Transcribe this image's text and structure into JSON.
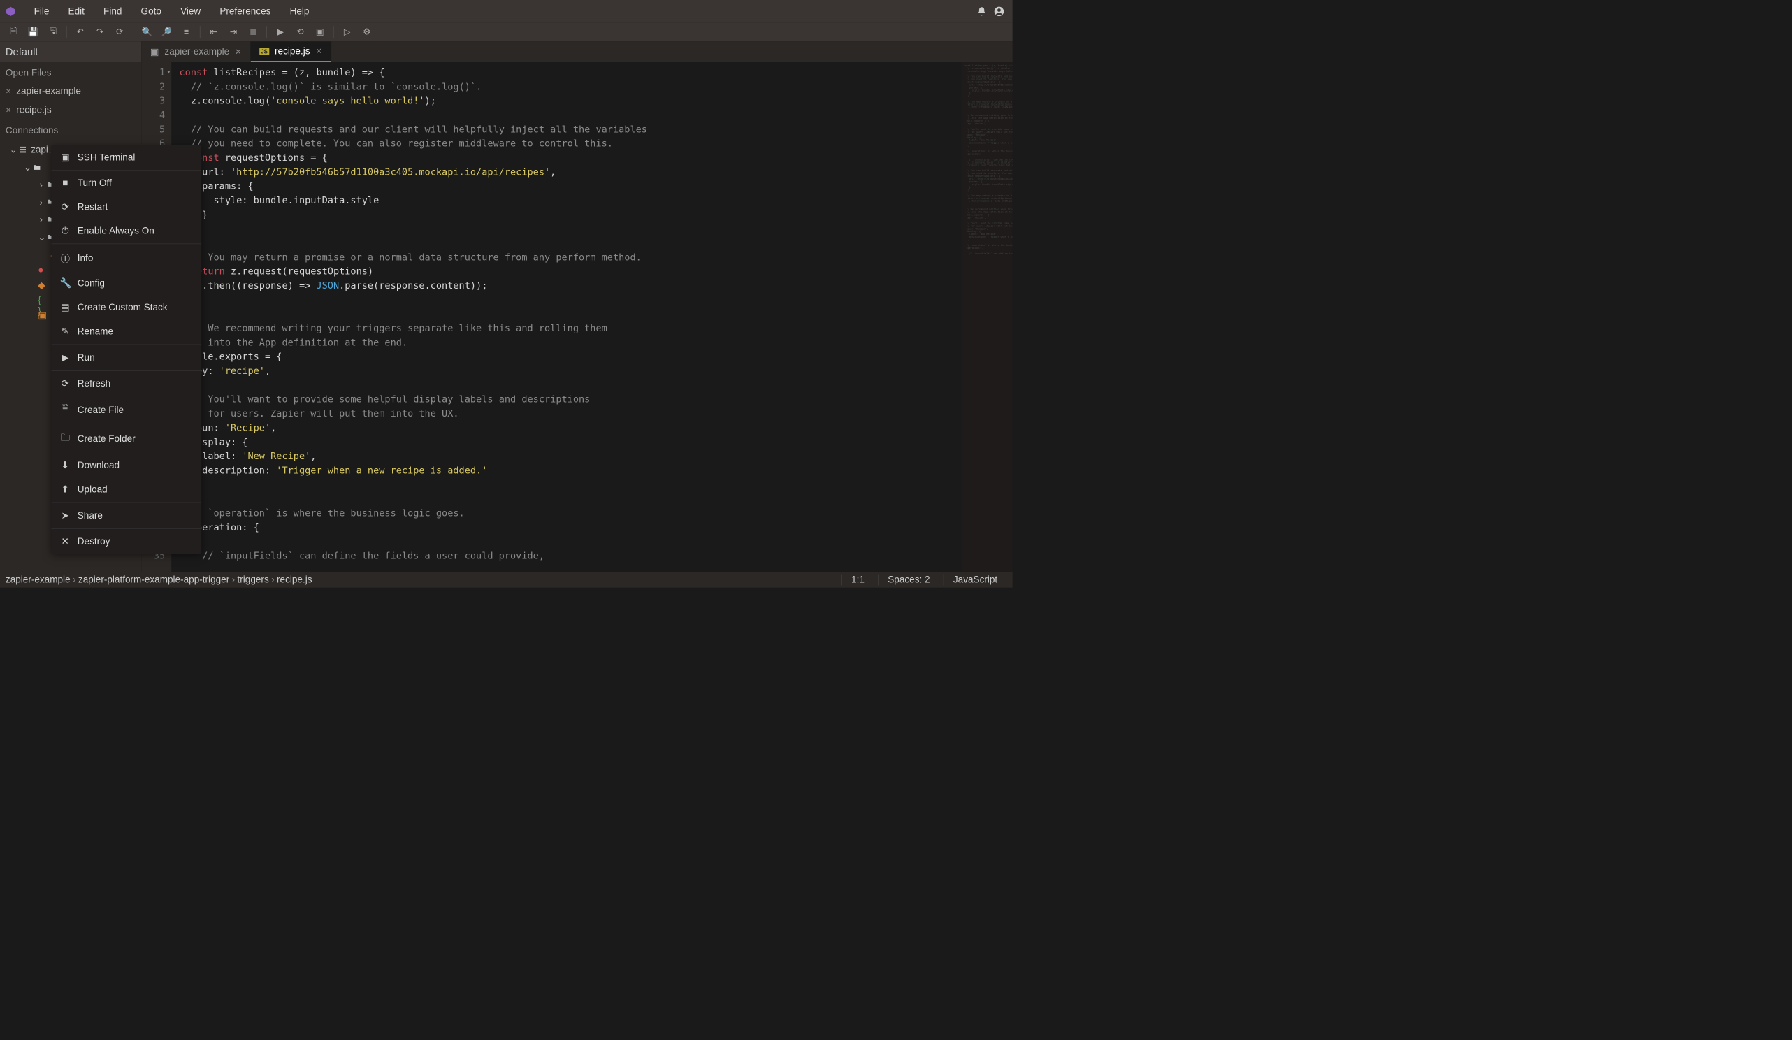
{
  "menu": {
    "items": [
      "File",
      "Edit",
      "Find",
      "Goto",
      "View",
      "Preferences",
      "Help"
    ]
  },
  "toolbar_icons": [
    "new",
    "save",
    "save-all",
    "|",
    "undo",
    "redo",
    "refresh",
    "|",
    "search",
    "search-replace",
    "format",
    "|",
    "outdent",
    "indent",
    "align-left",
    "|",
    "run",
    "run-history",
    "run-terminal",
    "|",
    "play",
    "settings"
  ],
  "panel_title": "Default",
  "sidebar": {
    "open_files_label": "Open Files",
    "open_files": [
      "zapier-example",
      "recipe.js"
    ],
    "connections_label": "Connections",
    "root": "zapi…"
  },
  "tabs": [
    {
      "icon": "terminal",
      "label": "zapier-example",
      "active": false
    },
    {
      "icon": "js",
      "label": "recipe.js",
      "active": true
    }
  ],
  "context_menu": [
    {
      "icon": "▣",
      "label": "SSH Terminal"
    },
    {
      "sep": true
    },
    {
      "icon": "■",
      "label": "Turn Off"
    },
    {
      "icon": "⟳",
      "label": "Restart"
    },
    {
      "icon": "⏻",
      "label": "Enable Always On"
    },
    {
      "sep": true
    },
    {
      "icon": "ⓘ",
      "label": "Info"
    },
    {
      "icon": "🔧",
      "label": "Config"
    },
    {
      "icon": "▤",
      "label": "Create Custom Stack"
    },
    {
      "icon": "✎",
      "label": "Rename"
    },
    {
      "sep": true
    },
    {
      "icon": "▶",
      "label": "Run"
    },
    {
      "sep": true
    },
    {
      "icon": "⟳",
      "label": "Refresh"
    },
    {
      "icon": "🗎",
      "label": "Create File"
    },
    {
      "icon": "🗀",
      "label": "Create Folder"
    },
    {
      "icon": "⬇",
      "label": "Download"
    },
    {
      "icon": "⬆",
      "label": "Upload"
    },
    {
      "sep": true
    },
    {
      "icon": "➤",
      "label": "Share"
    },
    {
      "sep": true
    },
    {
      "icon": "✕",
      "label": "Destroy"
    }
  ],
  "code_lines": [
    "<span class='tok-kw'>const</span> listRecipes <span class='tok-punc'>=</span> (z, bundle) <span class='tok-punc'>=&gt;</span> {",
    "  <span class='tok-cmt'>// `z.console.log()` is similar to `console.log()`.</span>",
    "  z.console.log(<span class='tok-str'>'console says hello world!'</span>);",
    "",
    "  <span class='tok-cmt'>// You can build requests and our client will helpfully inject all the variables</span>",
    "  <span class='tok-cmt'>// you need to complete. You can also register middleware to control this.</span>",
    "  <span class='tok-kw'>const</span> requestOptions <span class='tok-punc'>=</span> {",
    "    url: <span class='tok-str'>'http://57b20fb546b57d1100a3c405.mockapi.io/api/recipes'</span>,",
    "    params: {",
    "      style: bundle.inputData.style",
    "    }",
    "  };",
    "",
    "  <span class='tok-cmt'>// You may return a promise or a normal data structure from any perform method.</span>",
    "  <span class='tok-kw'>return</span> z.request(requestOptions)",
    "    .then((response) <span class='tok-punc'>=&gt;</span> <span class='tok-fn'>JSON</span>.parse(response.content));",
    "",
    "",
    "  <span class='tok-cmt'>// We recommend writing your triggers separate like this and rolling them</span>",
    "  <span class='tok-cmt'>// into the App definition at the end.</span>",
    "  <span class='tok-prop'>dule</span>.exports <span class='tok-punc'>=</span> {",
    "  key: <span class='tok-str'>'recipe'</span>,",
    "",
    "  <span class='tok-cmt'>// You'll want to provide some helpful display labels and descriptions</span>",
    "  <span class='tok-cmt'>// for users. Zapier will put them into the UX.</span>",
    "  noun: <span class='tok-str'>'Recipe'</span>,",
    "  display: {",
    "    label: <span class='tok-str'>'New Recipe'</span>,",
    "    description: <span class='tok-str'>'Trigger when a new recipe is added.'</span>",
    "  },",
    "",
    "  <span class='tok-cmt'>// `operation` is where the business logic goes.</span>",
    "  operation: {",
    "",
    "    <span class='tok-cmt'>// `inputFields` can define the fields a user could provide,</span>"
  ],
  "fold_lines": [
    1,
    7,
    9,
    21,
    27,
    33
  ],
  "breadcrumb": [
    "zapier-example",
    "zapier-platform-example-app-trigger",
    "triggers",
    "recipe.js"
  ],
  "status": {
    "pos": "1:1",
    "spaces": "Spaces: 2",
    "lang": "JavaScript"
  }
}
